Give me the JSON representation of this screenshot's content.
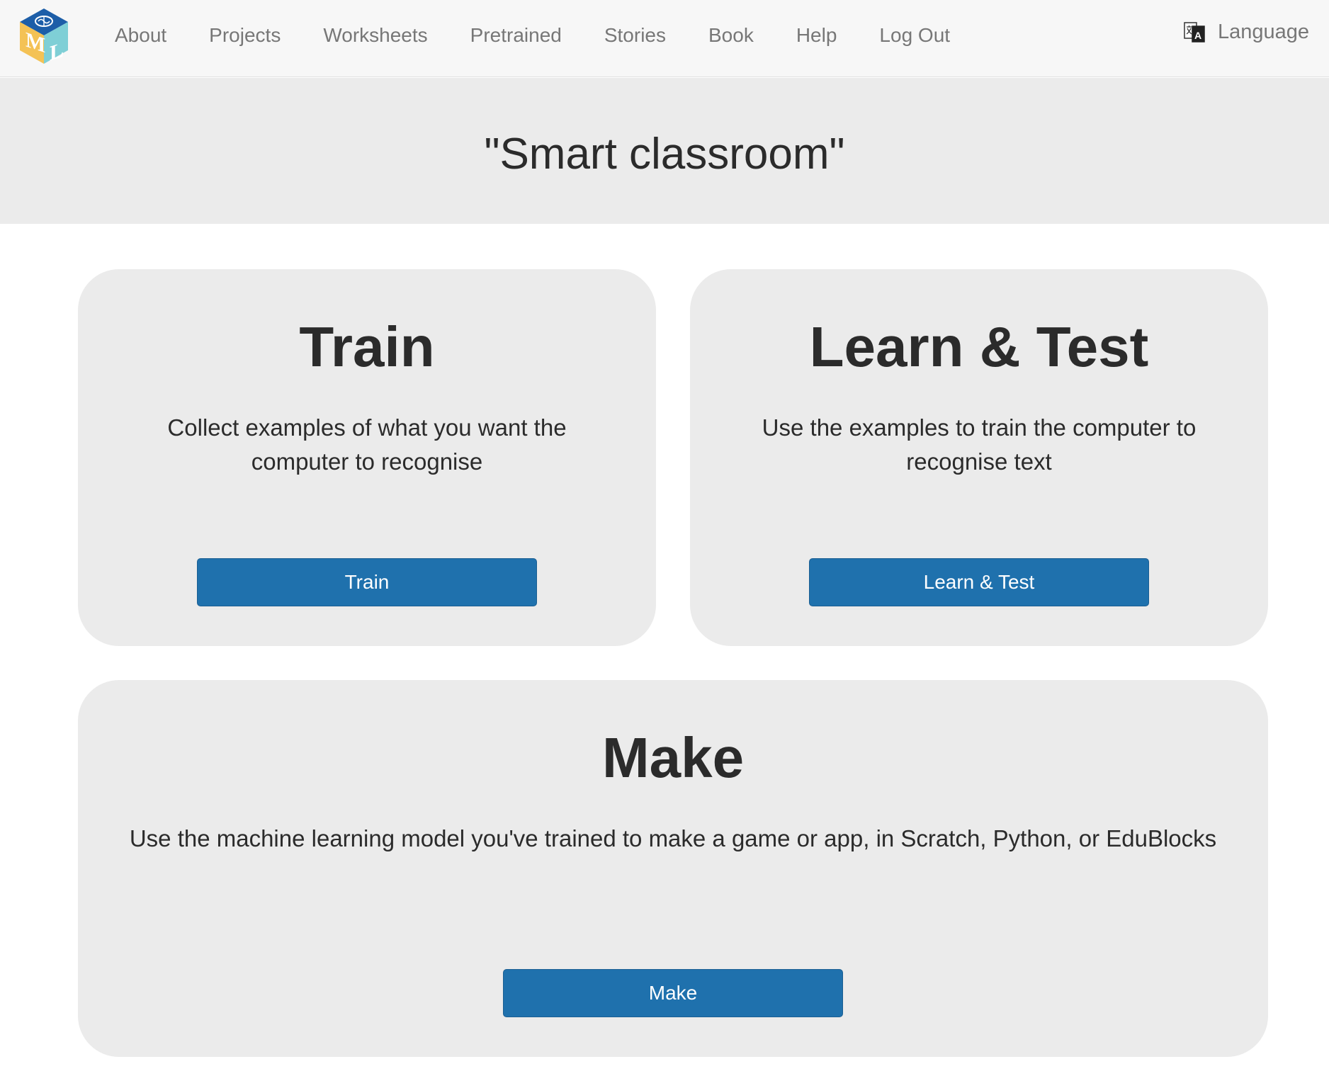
{
  "nav": {
    "logo_letters": [
      "M",
      "L"
    ],
    "links": [
      {
        "label": "About"
      },
      {
        "label": "Projects"
      },
      {
        "label": "Worksheets"
      },
      {
        "label": "Pretrained"
      },
      {
        "label": "Stories"
      },
      {
        "label": "Book"
      },
      {
        "label": "Help"
      },
      {
        "label": "Log Out"
      }
    ],
    "language": {
      "label": "Language",
      "icon": "translate-icon"
    }
  },
  "project": {
    "title": "\"Smart classroom\""
  },
  "cards": {
    "train": {
      "heading": "Train",
      "description": "Collect examples of what you want the computer to recognise",
      "button_label": "Train"
    },
    "learn": {
      "heading": "Learn & Test",
      "description": "Use the examples to train the computer to recognise text",
      "button_label": "Learn & Test"
    },
    "make": {
      "heading": "Make",
      "description": "Use the machine learning model you've trained to make a game or app, in Scratch, Python, or EduBlocks",
      "button_label": "Make"
    }
  },
  "colors": {
    "primary_button": "#1f71ad",
    "card_background": "#ebebeb",
    "nav_background": "#f7f7f7"
  }
}
